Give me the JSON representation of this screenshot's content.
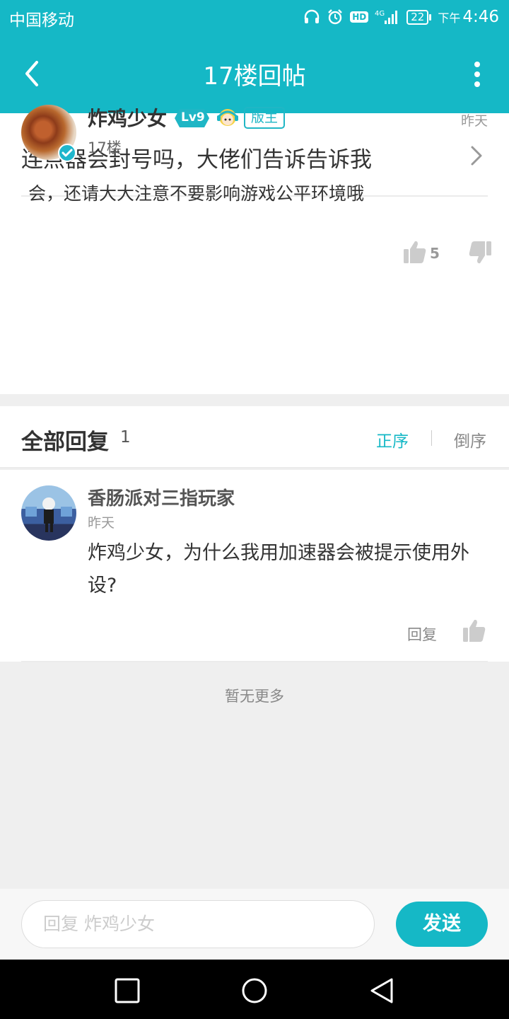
{
  "status_bar": {
    "carrier": "中国移动",
    "hd": "HD",
    "network": "4G",
    "battery": "22",
    "time_label": "下午",
    "time": "4:46"
  },
  "app_bar": {
    "title": "17楼回帖",
    "back_icon": "back-arrow-icon",
    "more_icon": "more-vert-icon"
  },
  "thread": {
    "title": "连点器会封号吗，大佬们告诉告诉我"
  },
  "op_post": {
    "author": "炸鸡少女",
    "level": "Lv9",
    "role": "版主",
    "floor": "17楼",
    "time": "昨天",
    "content": "会，还请大大注意不要影响游戏公平环境哦",
    "likes": "5"
  },
  "replies": {
    "header": "全部回复",
    "count": "1",
    "sort_asc": "正序",
    "sort_desc": "倒序",
    "items": [
      {
        "author": "香肠派对三指玩家",
        "time": "昨天",
        "text": "炸鸡少女，为什么我用加速器会被提示使用外设?",
        "reply_label": "回复"
      }
    ],
    "no_more": "暂无更多"
  },
  "reply_bar": {
    "placeholder": "回复 炸鸡少女",
    "send_label": "发送"
  },
  "colors": {
    "accent": "#15b8c6",
    "background": "#efefef"
  }
}
